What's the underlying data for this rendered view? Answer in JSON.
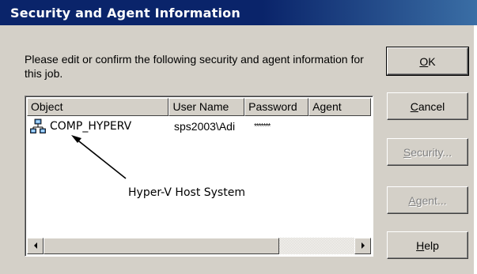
{
  "dialog": {
    "title": "Security and Agent Information",
    "description": "Please edit or confirm the following security and agent information for this job."
  },
  "buttons": {
    "ok": {
      "pre": "",
      "accel": "O",
      "post": "K"
    },
    "cancel": {
      "pre": "",
      "accel": "C",
      "post": "ancel"
    },
    "security": {
      "pre": "",
      "accel": "S",
      "post": "ecurity..."
    },
    "agent": {
      "pre": "",
      "accel": "A",
      "post": "gent..."
    },
    "help": {
      "pre": "",
      "accel": "H",
      "post": "elp"
    }
  },
  "list": {
    "columns": [
      "Object",
      "User Name",
      "Password",
      "Agent"
    ],
    "rows": [
      {
        "object": "COMP_HYPERV",
        "user_name": "sps2003\\Adi",
        "password": "*******",
        "agent": "",
        "icon": "network-computer-icon"
      }
    ]
  },
  "annotation": {
    "text": "Hyper-V Host System"
  },
  "colors": {
    "titlebar": "#0a246a",
    "dialog_bg": "#d4d0c8",
    "disabled_text": "#808080"
  }
}
